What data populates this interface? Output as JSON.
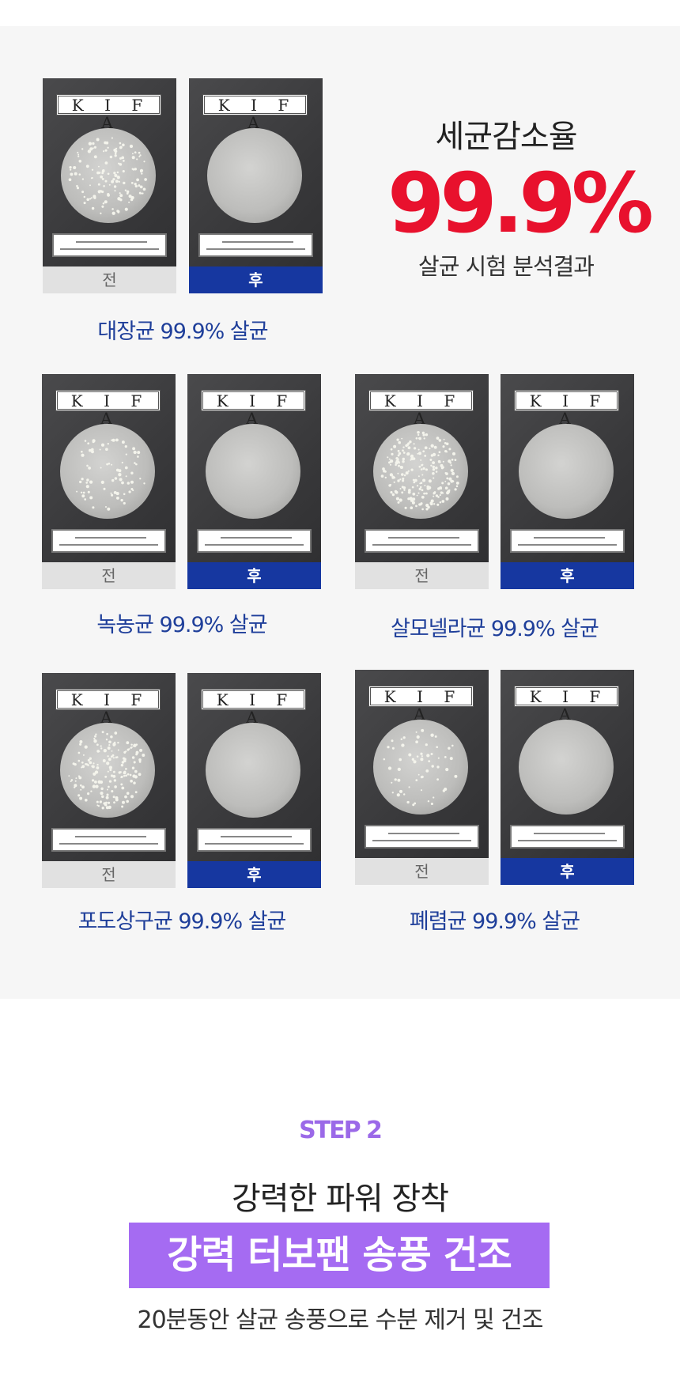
{
  "stat": {
    "title": "세균감소율",
    "value": "99.9%",
    "subtitle": "살균 시험 분석결과"
  },
  "plate_text": "K I F A",
  "before_label": "전",
  "after_label": "후",
  "tests": [
    {
      "caption": "대장균 99.9% 살균"
    },
    {
      "caption": "녹농균 99.9% 살균"
    },
    {
      "caption": "살모넬라균 99.9% 살균"
    },
    {
      "caption": "포도상구균 99.9% 살균"
    },
    {
      "caption": "폐렴균 99.9% 살균"
    }
  ],
  "step": {
    "label": "STEP 2",
    "heading": "강력한 파워 장착",
    "banner": "강력 터보팬 송풍 건조",
    "description": "20분동안 살균 송풍으로 수분 제거 및 건조"
  },
  "colors": {
    "accent_red": "#e8112d",
    "after_tag_blue": "#1637a0",
    "caption_blue": "#1f3f9a",
    "step_purple": "#9b69e8",
    "banner_purple": "#a56bf2"
  }
}
